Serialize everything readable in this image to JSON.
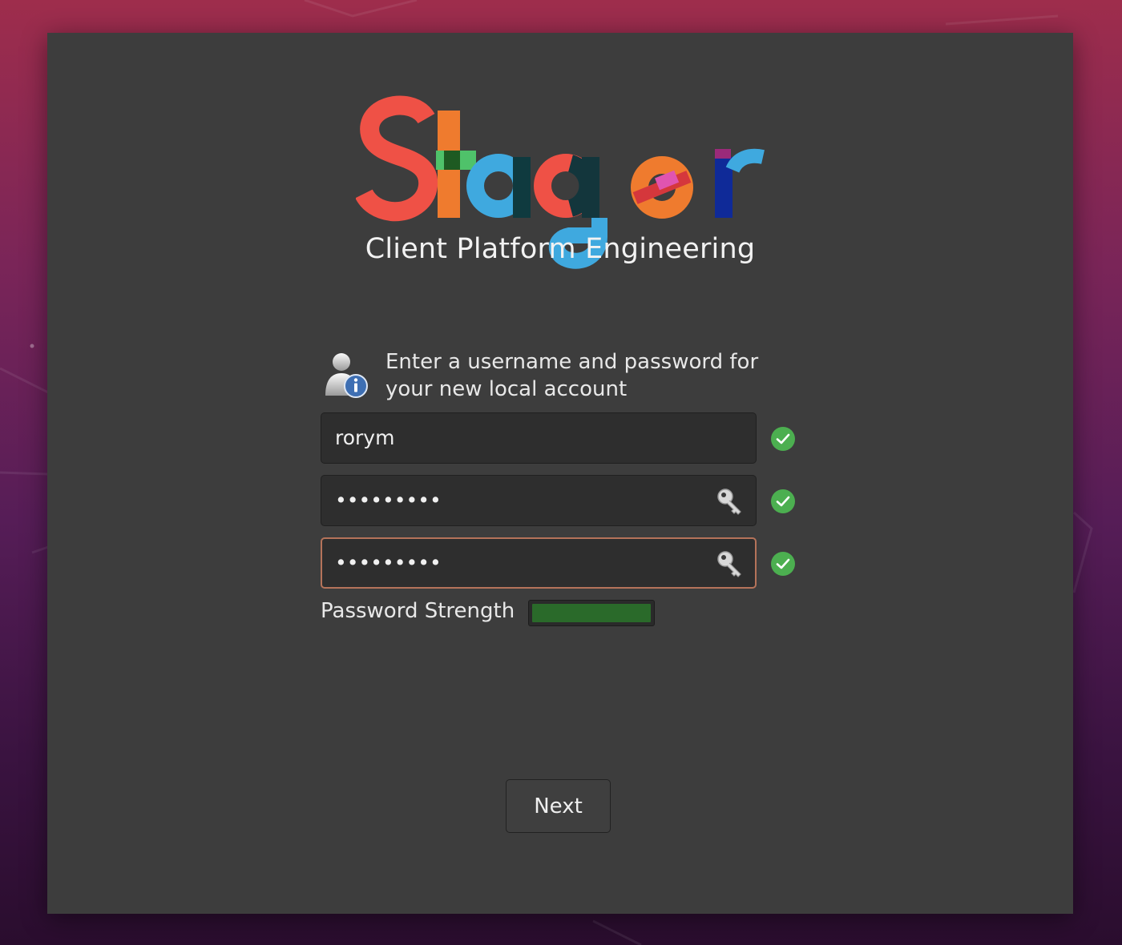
{
  "brand": {
    "logo_text": "Stager",
    "subtitle": "Client Platform Engineering"
  },
  "account_form": {
    "prompt_line1": "Enter a username and password for",
    "prompt_line2": "your new local account",
    "username": {
      "value": "rorym",
      "valid": true,
      "status_icon": "check-circle-icon"
    },
    "password": {
      "value": "•••••••••",
      "valid": true,
      "reveal_icon": "key-icon",
      "status_icon": "check-circle-icon"
    },
    "confirm_password": {
      "value": "•••••••••",
      "valid": true,
      "focused": true,
      "reveal_icon": "key-icon",
      "status_icon": "check-circle-icon"
    },
    "strength": {
      "label": "Password Strength",
      "level": 1.0,
      "color": "#2a6a2a"
    }
  },
  "actions": {
    "next_label": "Next"
  },
  "colors": {
    "dialog_bg": "#3d3d3d",
    "field_bg": "#2e2e2e",
    "focus_border": "#b5735a",
    "valid_green": "#4caf50",
    "logo_red": "#ef5146",
    "logo_orange": "#ef7b2e",
    "logo_blue": "#3fa9df",
    "logo_green": "#4fc26a",
    "logo_navy": "#0f2a98"
  }
}
